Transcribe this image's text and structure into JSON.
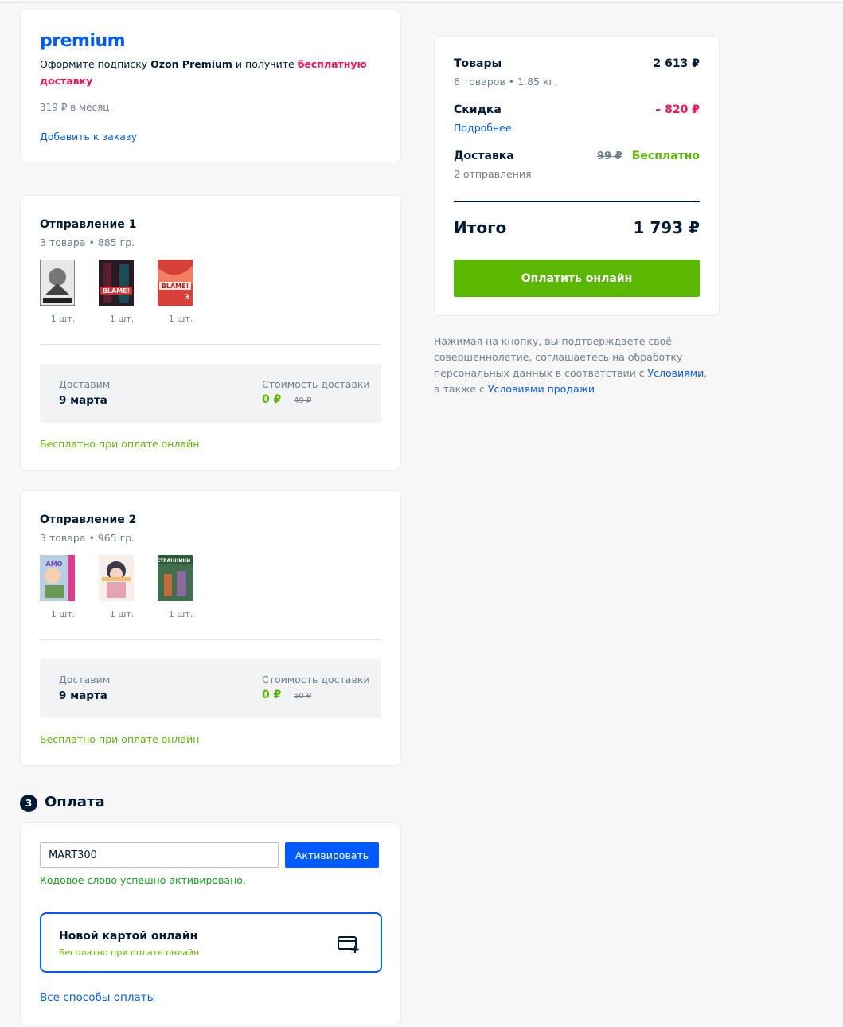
{
  "premium": {
    "logo": "premium",
    "text_prefix": "Оформите подписку ",
    "text_brand": "Ozon Premium",
    "text_mid": " и получите ",
    "text_highlight": "бесплатную доставку",
    "price": "319 ₽ в месяц",
    "add_link": "Добавить к заказу"
  },
  "shipments": [
    {
      "title": "Отправление 1",
      "sub": "3 товара • 885 гр.",
      "items": [
        {
          "qty": "1 шт.",
          "cover_color": "#d9d9d9",
          "cover_text": "ISHDSHIKI"
        },
        {
          "qty": "1 шт.",
          "cover_color": "#2a1a24",
          "cover_text": "BLAME!"
        },
        {
          "qty": "1 шт.",
          "cover_color": "#d8413a",
          "cover_text": "BLAME! 3"
        }
      ],
      "delivery_label": "Доставим",
      "delivery_date": "9 марта",
      "cost_label": "Стоимость доставки",
      "cost_value": "0 ₽",
      "cost_old": "49 ₽",
      "free_note": "Бесплатно при оплате онлайн"
    },
    {
      "title": "Отправление 2",
      "sub": "3 товара • 965 гр.",
      "items": [
        {
          "qty": "1 шт.",
          "cover_color": "#b7cfe0",
          "cover_text": "AMO"
        },
        {
          "qty": "1 шт.",
          "cover_color": "#f1e7df",
          "cover_text": ""
        },
        {
          "qty": "1 шт.",
          "cover_color": "#3f6f4c",
          "cover_text": "СТРАННИКИ"
        }
      ],
      "delivery_label": "Доставим",
      "delivery_date": "9 марта",
      "cost_label": "Стоимость доставки",
      "cost_value": "0 ₽",
      "cost_old": "50 ₽",
      "free_note": "Бесплатно при оплате онлайн"
    }
  ],
  "payment": {
    "step_number": "3",
    "title": "Оплата",
    "code_value": "MART300",
    "activate_label": "Активировать",
    "success_msg": "Кодовое слово успешно активировано.",
    "card_title": "Новой картой онлайн",
    "card_note": "Бесплатно при оплате онлайн",
    "card_icon": "add-card-icon",
    "all_methods": "Все способы оплаты"
  },
  "summary": {
    "goods_label": "Товары",
    "goods_sub": "6 товаров • 1.85 кг.",
    "goods_value": "2 613 ₽",
    "discount_label": "Скидка",
    "discount_link": "Подробнее",
    "discount_value": "– 820 ₽",
    "delivery_label": "Доставка",
    "delivery_sub": "2 отправления",
    "delivery_old": "99 ₽",
    "delivery_value": "Бесплатно",
    "total_label": "Итого",
    "total_value": "1 793 ₽",
    "pay_button": "Оплатить онлайн"
  },
  "legal": {
    "text1": "Нажимая на кнопку, вы подтверждаете своё совершеннолетие, соглашаетесь на обработку персональных данных в соответствии с ",
    "link1": "Условиями",
    "text2": ", а также с ",
    "link2": "Условиями продажи"
  },
  "colors": {
    "accent_blue": "#005bff",
    "green": "#5bb800",
    "pink": "#f91155"
  }
}
